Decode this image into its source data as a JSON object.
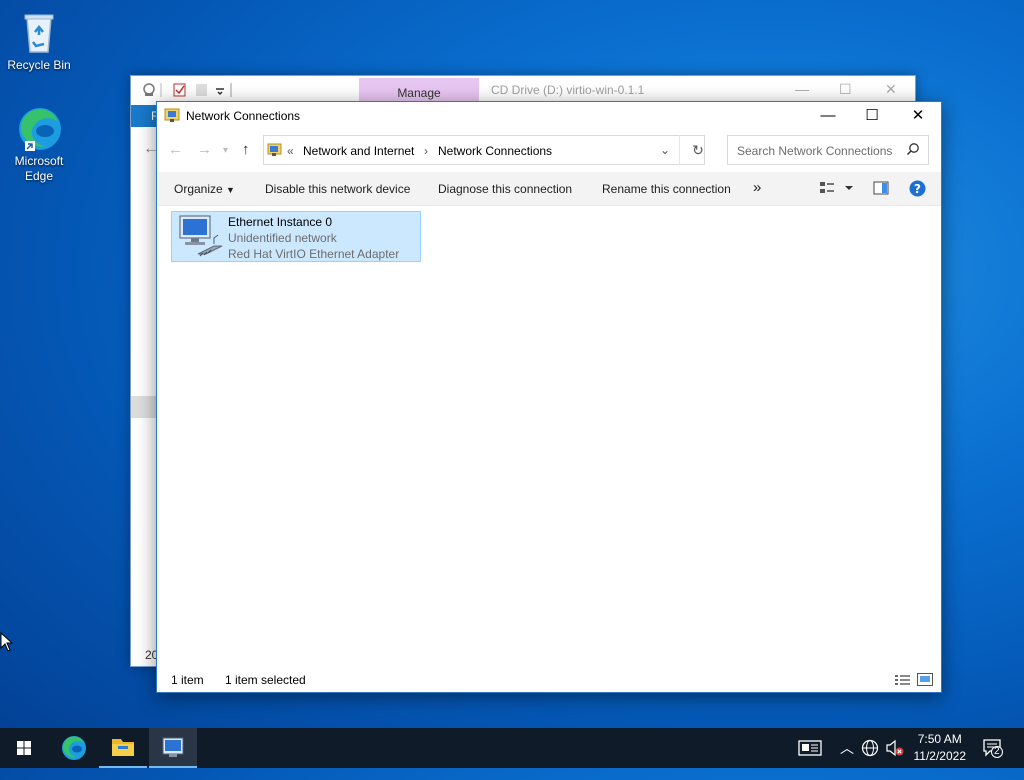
{
  "desktop": {
    "icons": [
      {
        "label": "Recycle Bin"
      },
      {
        "label": "Microsoft Edge"
      }
    ]
  },
  "bg_window": {
    "manage_tab": "Manage",
    "title": "CD Drive (D:) virtio-win-0.1.1",
    "ribbon_tab": "F",
    "status_partial": "20"
  },
  "window": {
    "title": "Network Connections",
    "address": {
      "overflow": "«",
      "crumbs": [
        "Network and Internet",
        "Network Connections"
      ]
    },
    "search_placeholder": "Search Network Connections",
    "commands": {
      "organize": "Organize",
      "disable": "Disable this network device",
      "diagnose": "Diagnose this connection",
      "rename": "Rename this connection",
      "more": "»"
    },
    "items": [
      {
        "name": "Ethernet Instance 0",
        "status": "Unidentified network",
        "adapter": "Red Hat VirtIO Ethernet Adapter"
      }
    ],
    "status": {
      "count": "1 item",
      "selected": "1 item selected"
    }
  },
  "taskbar": {
    "time": "7:50 AM",
    "date": "11/2/2022",
    "notification_count": "2"
  },
  "colors": {
    "accent": "#0078d7",
    "selection": "#cce8ff",
    "taskbar": "#101b29"
  }
}
